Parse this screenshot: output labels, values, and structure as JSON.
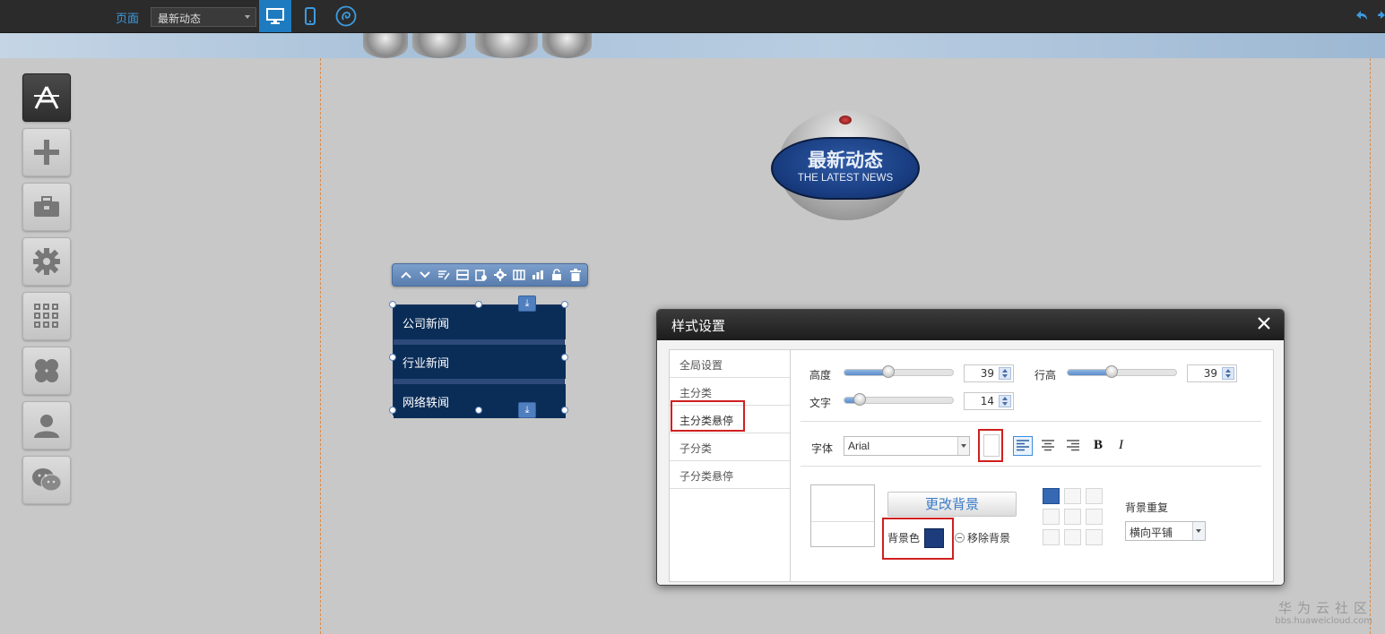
{
  "topbar": {
    "page_label": "页面",
    "page_select_value": "最新动态"
  },
  "badge": {
    "title_cn": "最新动态",
    "title_en": "THE LATEST NEWS"
  },
  "nav_widget": {
    "items": [
      "公司新闻",
      "行业新闻",
      "网络轶闻"
    ]
  },
  "dialog": {
    "title": "样式设置",
    "tabs": [
      "全局设置",
      "主分类",
      "主分类悬停",
      "子分类",
      "子分类悬停"
    ],
    "active_tab": "主分类悬停",
    "height_label": "高度",
    "height_value": "39",
    "line_height_label": "行高",
    "line_height_value": "39",
    "text_label": "文字",
    "text_value": "14",
    "font_label": "字体",
    "font_value": "Arial",
    "bold_label": "B",
    "italic_label": "I",
    "change_bg_label": "更改背景",
    "bg_color_label": "背景色",
    "bg_color": "#1c3c7c",
    "remove_bg_label": "移除背景",
    "bg_repeat_label": "背景重复",
    "bg_repeat_value": "横向平铺"
  },
  "watermark": {
    "cn": "华为云社区",
    "url": "bbs.huaweicloud.com"
  },
  "colors": {
    "accent": "#1e7bc0",
    "highlight": "#d01f1f",
    "nav_bg": "#0a2d58"
  }
}
